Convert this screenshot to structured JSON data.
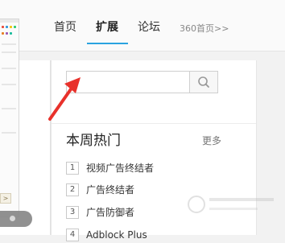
{
  "nav": {
    "home": "首页",
    "extensions": "扩展",
    "forum": "论坛",
    "site_home": "360首页>>"
  },
  "search": {
    "value": "",
    "placeholder": ""
  },
  "hot": {
    "title": "本周热门",
    "more": "更多",
    "items": [
      {
        "num": "1",
        "label": "视频广告终结者"
      },
      {
        "num": "2",
        "label": "广告终结者"
      },
      {
        "num": "3",
        "label": "广告防御者"
      },
      {
        "num": "4",
        "label": "Adblock Plus"
      }
    ]
  },
  "preview": {
    "button": ">"
  },
  "colors": {
    "accent": "#2aa3e0",
    "arrow": "#e8312b"
  }
}
